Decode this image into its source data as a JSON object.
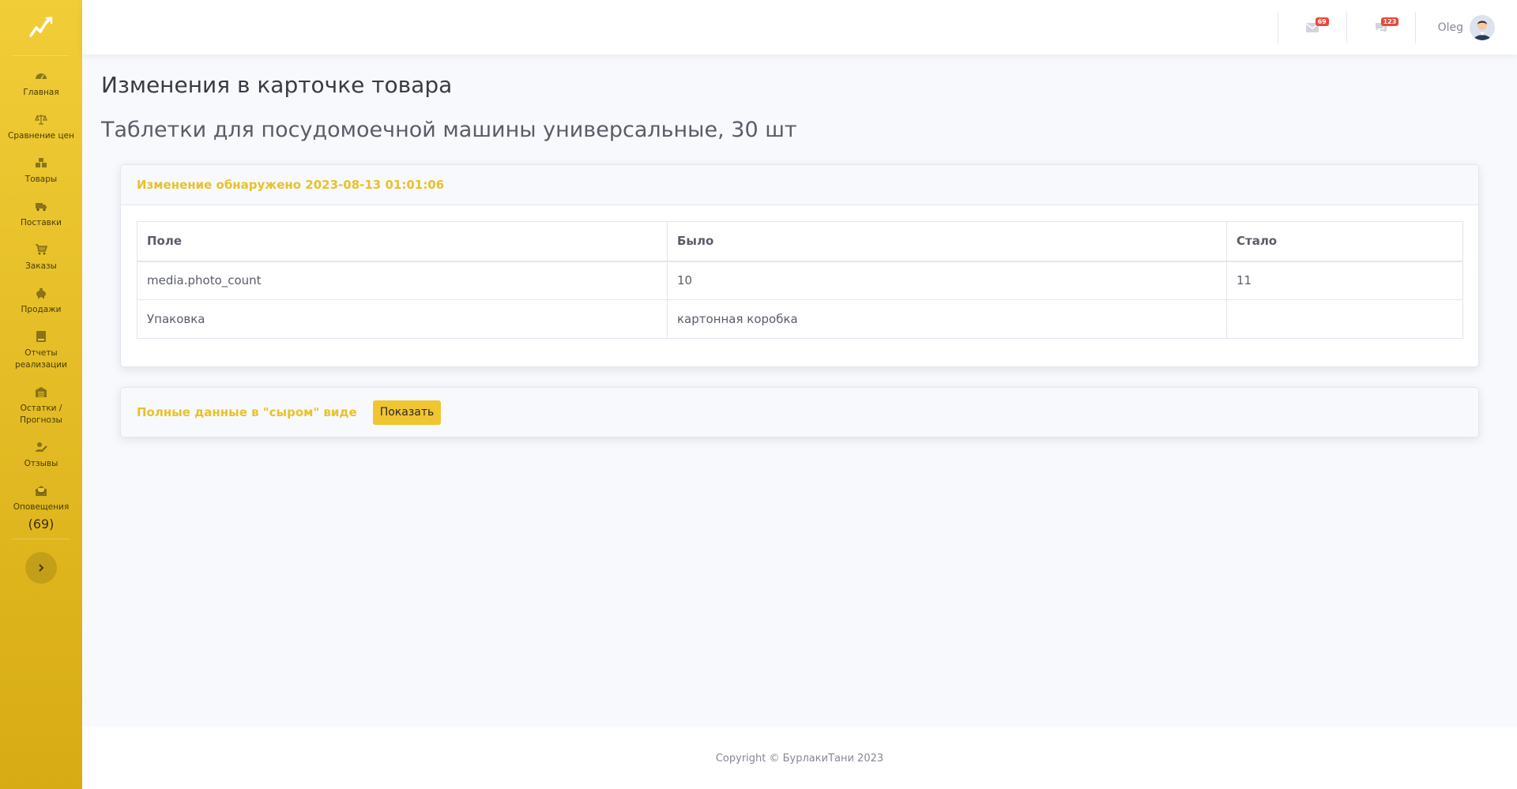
{
  "sidebar": {
    "brand_icon": "chart-trend-icon",
    "items": [
      {
        "label": "Главная",
        "icon": "gauge-icon"
      },
      {
        "label": "Сравнение цен",
        "icon": "scales-icon"
      },
      {
        "label": "Товары",
        "icon": "boxes-icon"
      },
      {
        "label": "Поставки",
        "icon": "truck-icon"
      },
      {
        "label": "Заказы",
        "icon": "cart-icon"
      },
      {
        "label": "Продажи",
        "icon": "piggy-bank-icon"
      },
      {
        "label": "Отчеты реализации",
        "icon": "book-icon"
      },
      {
        "label": "Остатки / Прогнозы",
        "icon": "warehouse-icon"
      },
      {
        "label": "Отзывы",
        "icon": "user-edit-icon"
      },
      {
        "label": "Оповещения",
        "icon": "envelope-open-icon",
        "count": "(69)"
      }
    ],
    "toggle_icon": "chevron-right-icon"
  },
  "topbar": {
    "messages_badge": "69",
    "notifications_badge": "123",
    "user_name": "Oleg"
  },
  "main": {
    "title": "Изменения в карточке товара",
    "subtitle": "Таблетки для посудомоечной машины универсальные, 30 шт",
    "change_card": {
      "header": "Изменение обнаружено 2023-08-13 01:01:06",
      "columns": [
        "Поле",
        "Было",
        "Стало"
      ],
      "rows": [
        [
          "media.photo_count",
          "10",
          "11"
        ],
        [
          "Упаковка",
          "картонная коробка",
          ""
        ]
      ]
    },
    "raw_card": {
      "label": "Полные данные в \"сыром\" виде",
      "button": "Показать"
    }
  },
  "footer": {
    "copyright": "Copyright © БурлакиТани 2023"
  },
  "colors": {
    "sidebar_top": "#f1cd37",
    "sidebar_bottom": "#d7ab13",
    "accent_text": "#e9c129",
    "badge": "#e74a3b"
  }
}
